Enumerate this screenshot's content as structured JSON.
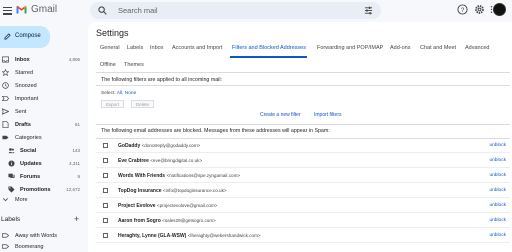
{
  "header": {
    "brand": "Gmail",
    "search_placeholder": "Search mail",
    "icons": [
      "menu-icon",
      "gmail-logo",
      "search-icon",
      "tune-icon",
      "help-icon",
      "settings-icon",
      "apps-icon",
      "avatar"
    ]
  },
  "sidebar": {
    "compose": "Compose",
    "items": [
      {
        "label": "Inbox",
        "count": "4,806",
        "icon": "inbox-icon"
      },
      {
        "label": "Starred",
        "count": "",
        "icon": "star-icon"
      },
      {
        "label": "Snoozed",
        "count": "",
        "icon": "clock-icon"
      },
      {
        "label": "Important",
        "count": "",
        "icon": "important-icon"
      },
      {
        "label": "Sent",
        "count": "",
        "icon": "send-icon"
      },
      {
        "label": "Drafts",
        "count": "61",
        "icon": "draft-icon"
      },
      {
        "label": "Categories",
        "count": "",
        "icon": "label-icon"
      },
      {
        "label": "Social",
        "count": "143",
        "icon": "people-icon"
      },
      {
        "label": "Updates",
        "count": "4,311",
        "icon": "info-icon"
      },
      {
        "label": "Forums",
        "count": "9",
        "icon": "forum-icon"
      },
      {
        "label": "Promotions",
        "count": "12,672",
        "icon": "tag-icon"
      },
      {
        "label": "More",
        "count": "",
        "icon": "chevron-down-icon"
      }
    ],
    "labels_heading": "Labels",
    "labels_add": "+",
    "labels": [
      "Away with Words",
      "Boomerang"
    ]
  },
  "settings": {
    "title": "Settings",
    "tabs": [
      "General",
      "Labels",
      "Inbox",
      "Accounts and Import",
      "Filters and Blocked Addresses",
      "Forwarding and POP/IMAP",
      "Add-ons",
      "Chat and Meet",
      "Advanced",
      "Offline",
      "Themes"
    ],
    "filters_heading": "The following filters are applied to all incoming mail:",
    "select_label": "Select:",
    "select_all": "All",
    "select_none": "None",
    "export_label": "Export",
    "delete_label": "Delete",
    "create_filter": "Create a new filter",
    "import_filters": "Import filters",
    "blocked_heading": "The following email addresses are blocked. Messages from these addresses will appear in Spam:",
    "unblock_label": "unblock",
    "blocked": [
      {
        "name": "GoDaddy",
        "email": "<donotreply@godaddy.com>"
      },
      {
        "name": "Eve Crabtree",
        "email": "<eve@bringdigital.co.uk>"
      },
      {
        "name": "Words With Friends",
        "email": "<notifications@spe.zyngamail.com>"
      },
      {
        "name": "TopDog Insurance",
        "email": "<info@topdoginsurance.co.uk>"
      },
      {
        "name": "Project Evolove",
        "email": "<projectevolove@gmail.com>"
      },
      {
        "name": "Aaron from Sogro",
        "email": "<sales29@getsogro.com>"
      },
      {
        "name": "Heraghty, Lynne (GLA-WSW)",
        "email": "<lheraghty@webershandwick.com>"
      }
    ]
  }
}
